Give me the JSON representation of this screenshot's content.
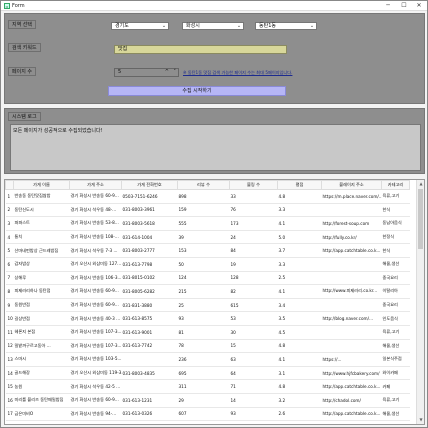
{
  "window": {
    "title": "Form",
    "icon": "form-icon",
    "minimize": "─",
    "maximize": "☐",
    "close": "✕"
  },
  "region": {
    "label": "지역 선택",
    "province": "경기도",
    "city": "화성시",
    "district": "동탄1동"
  },
  "search": {
    "label": "검색 키워드",
    "value": "맛집"
  },
  "pages": {
    "label": "페이지 수",
    "value": "5",
    "hint": "※ 동탄1동 맛집 검색 가능한 페이지 수는 최대 5페이지입니다."
  },
  "collect_button": "수집 시작하기",
  "log": {
    "label": "시스템 로그",
    "text": "모든 페이지가 성공적으로 수집되었습니다!"
  },
  "table": {
    "columns": [
      "가게 이름",
      "가게 주소",
      "가게 전화번호",
      "리뷰 수",
      "블링 수",
      "평점",
      "블레이지 주소",
      "카테고리"
    ],
    "rows": [
      [
        "1",
        "반송동 동탄맛집쌈밥",
        "경기 화성시 반송동 60-9...",
        "0503-7151-6246",
        "898",
        "33",
        "4.8",
        "https://m.place.naver.com/...",
        "육류,고기"
      ],
      [
        "2",
        "동탄신도시",
        "경기 화성시 석우동 48-...",
        "031-8003-3961",
        "159",
        "76",
        "3.3",
        "",
        "한식"
      ],
      [
        "3",
        "파파스트",
        "경기 화성시 반송동 53-8...",
        "031-8003-5618",
        "555",
        "173",
        "4.1",
        "http://forest-soup.com",
        "동남아음식"
      ],
      [
        "4",
        "통치",
        "경기 화성시 반송동 108-...",
        "031-614-1004",
        "39",
        "24",
        "5.0",
        "http://fully.co.kr/",
        "한정식"
      ],
      [
        "5",
        "산마네펀밥상 근드레밥집",
        "경기 화성시 석우동 7-3 ...",
        "031-8003-2777",
        "153",
        "84",
        "3.7",
        "http://app.catchtable.co.k...",
        "한식"
      ],
      [
        "6",
        "감자밥상",
        "경기 오산시 외삼미동 127...",
        "031-613-7798",
        "50",
        "19",
        "3.3",
        "",
        "해물,생선"
      ],
      [
        "7",
        "상해루",
        "경기 화성시 반송동 106-3...",
        "031-8015-0102",
        "124",
        "128",
        "2.5",
        "",
        "중국요리"
      ],
      [
        "8",
        "피제러리하나 동탄점",
        "경기 화성시 반송동 60-9...",
        "031-8005-6282",
        "215",
        "82",
        "4.1",
        "http://www.피제러리.co.kr...",
        "이탈리아"
      ],
      [
        "9",
        "동원반점",
        "경기 화성시 반송동 60-9...",
        "031-831-3880",
        "25",
        "615",
        "3.4",
        "",
        "중국요리"
      ],
      [
        "10",
        "길상반점",
        "경기 화성시 반송동 40-3 ...",
        "031-613-8575",
        "93",
        "53",
        "3.5",
        "http://blog.naver.com/...",
        "인도음식"
      ],
      [
        "11",
        "헤론지 본점",
        "경기 화성시 반송동 107-3...",
        "031-613-9001",
        "81",
        "30",
        "4.5",
        "",
        "육류,고기"
      ],
      [
        "12",
        "밀밭까구르고동아 ...",
        "경기 화성시 반송동 107-3...",
        "031-613-7742",
        "78",
        "15",
        "4.8",
        "",
        "해물,생선"
      ],
      [
        "13",
        "스마시",
        "경기 화성시 반송동 103-5...",
        "",
        "236",
        "63",
        "4.1",
        "https://...",
        "일본식주점"
      ],
      [
        "14",
        "골드해장",
        "경기 오산시 외삼미동 119-3...",
        "031-8003-4835",
        "695",
        "64",
        "3.1",
        "http://www.hjfcbakery.com/",
        "와이카페"
      ],
      [
        "15",
        "농원",
        "경기 화성시 석우동 42-5 ...",
        "",
        "311",
        "71",
        "4.8",
        "http://app.catchtable.co.k...",
        "카페"
      ],
      [
        "16",
        "미리를 블리즈 동탄때밀밥집",
        "경기 화성시 반송동 60-9...",
        "031-613-1231",
        "29",
        "14",
        "3.2",
        "http://chadol.com/",
        "육류,고기"
      ],
      [
        "17",
        "금은미비O",
        "경기 화성시 반송동 94-...",
        "031-613-0326",
        "607",
        "93",
        "2.6",
        "http://app.catchtable.co.k...",
        "해물,생선"
      ]
    ]
  }
}
